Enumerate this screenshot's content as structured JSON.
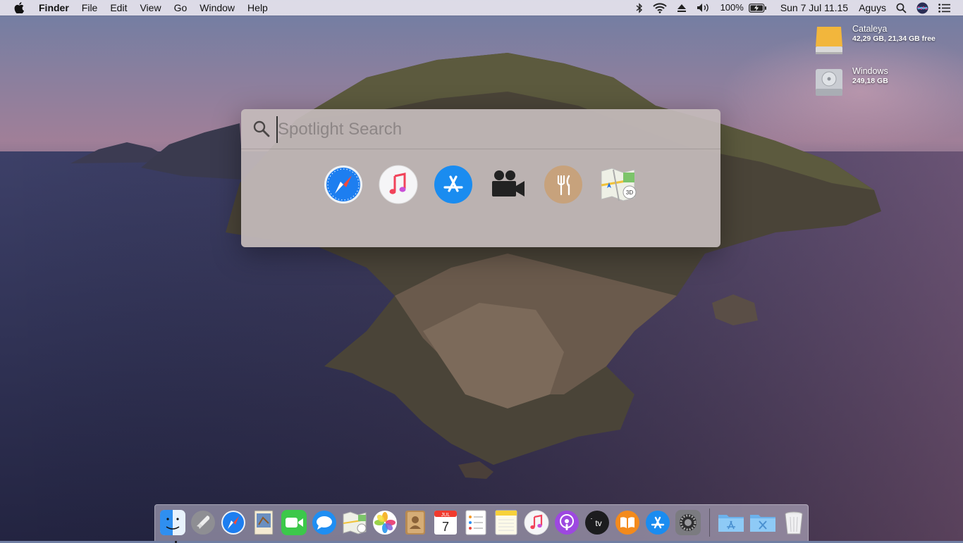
{
  "menubar": {
    "app_name": "Finder",
    "menus": [
      "File",
      "Edit",
      "View",
      "Go",
      "Window",
      "Help"
    ],
    "battery": "100%",
    "datetime": "Sun 7 Jul  11.15",
    "user": "Aguys"
  },
  "desktop": {
    "drives": [
      {
        "name": "Cataleya",
        "info": "42,29 GB, 21,34 GB free",
        "icon": "external-drive-icon",
        "color": "#f0b43a"
      },
      {
        "name": "Windows",
        "info": "249,18 GB",
        "icon": "hard-drive-icon",
        "color": "#c7cbd1"
      }
    ]
  },
  "spotlight": {
    "placeholder": "Spotlight Search",
    "value": "",
    "suggestions": [
      "safari-icon",
      "music-icon",
      "app-store-icon",
      "movies-icon",
      "restaurants-icon",
      "maps-icon"
    ]
  },
  "dock": {
    "apps": [
      "finder-icon",
      "launchpad-icon",
      "safari-icon",
      "mail-icon",
      "facetime-icon",
      "messages-icon",
      "maps-icon",
      "photos-icon",
      "contacts-icon",
      "calendar-icon",
      "reminders-icon",
      "notes-icon",
      "music-icon",
      "podcasts-icon",
      "apple-tv-icon",
      "books-icon",
      "app-store-icon",
      "system-preferences-icon"
    ],
    "others": [
      "applications-folder-icon",
      "utilities-folder-icon",
      "trash-icon"
    ],
    "calendar": {
      "month": "JUL",
      "day": "7"
    },
    "tv_label": "tv",
    "running": [
      "finder-icon"
    ]
  },
  "colors": {
    "accent": "#1a8cf0",
    "menubar": "#ece8f0",
    "spotlight": "#c4baba"
  }
}
